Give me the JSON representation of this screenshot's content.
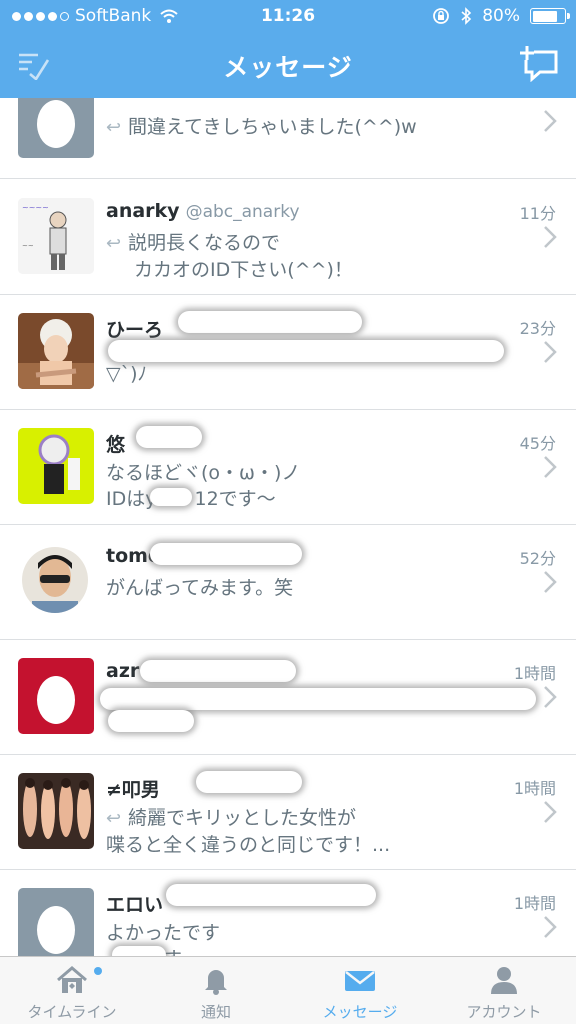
{
  "statusbar": {
    "carrier": "SoftBank",
    "time": "11:26",
    "battery": "80%",
    "battery_level": 0.8
  },
  "nav": {
    "title": "メッセージ"
  },
  "messages": [
    {
      "name": "",
      "handle": "",
      "time": "",
      "text": [
        "間違えてきしちゃいました(^^)w"
      ],
      "replied": true
    },
    {
      "name": "anarky",
      "handle": "@abc_anarky",
      "time": "11分",
      "text": [
        "説明長くなるので",
        "カカオのID下さい(^^)！"
      ],
      "replied": true
    },
    {
      "name": "ひーろ",
      "handle": "",
      "time": "23分",
      "text": [
        "",
        "▽`)ﾉ"
      ],
      "replied": false
    },
    {
      "name": "悠",
      "handle": "",
      "time": "45分",
      "text": [
        "なるほどヾ(o・ω・)ノ",
        "IDはy　　12です〜"
      ],
      "replied": false
    },
    {
      "name": "tomo",
      "handle": "",
      "time": "52分",
      "text": [
        "がんばってみます。笑"
      ],
      "replied": false
    },
    {
      "name": "azr",
      "handle": "",
      "time": "1時間",
      "text": [
        "",
        ""
      ],
      "replied": false
    },
    {
      "name": "≠叩男",
      "handle": "",
      "time": "1時間",
      "text": [
        "綺麗でキリッとした女性が",
        "喋ると全く違うのと同じです！..."
      ],
      "replied": true
    },
    {
      "name": "エロい",
      "handle": "",
      "time": "1時間",
      "text": [
        "よかったです",
        "　　です"
      ],
      "replied": false
    }
  ],
  "tabs": [
    {
      "label": "タイムライン",
      "icon": "home-icon"
    },
    {
      "label": "通知",
      "icon": "bell-icon"
    },
    {
      "label": "メッセージ",
      "icon": "envelope-icon"
    },
    {
      "label": "アカウント",
      "icon": "person-icon"
    }
  ],
  "colors": {
    "header": "#5aacec",
    "accent": "#55acee",
    "tab_inactive": "#8f9ba6"
  }
}
